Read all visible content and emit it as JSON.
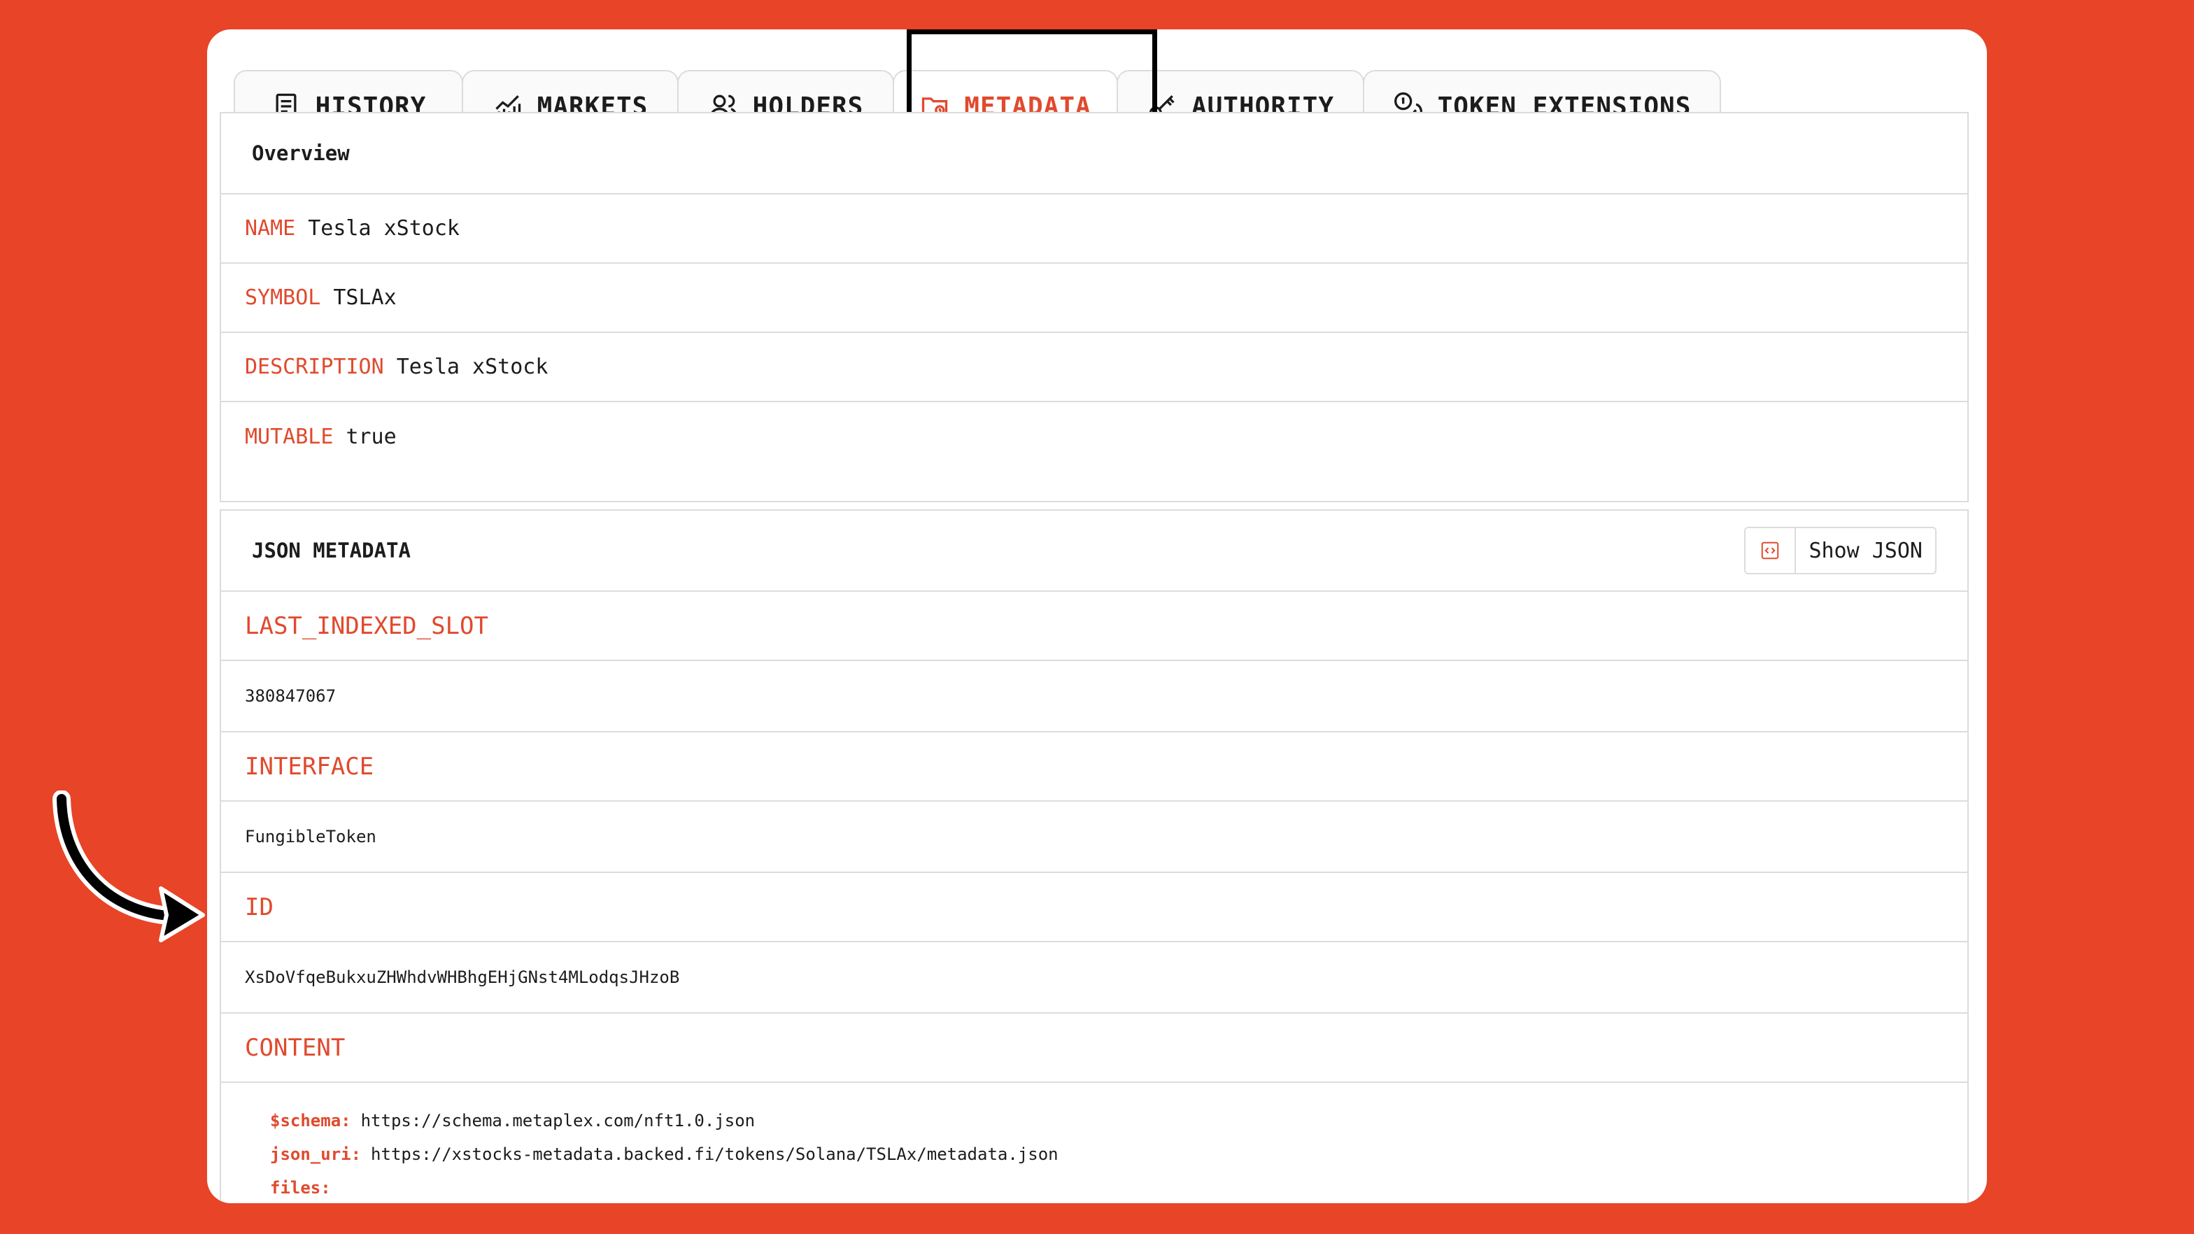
{
  "tabs": [
    {
      "label": "HISTORY",
      "icon": "receipt-icon"
    },
    {
      "label": "MARKETS",
      "icon": "chart-icon"
    },
    {
      "label": "HOLDERS",
      "icon": "users-icon"
    },
    {
      "label": "METADATA",
      "icon": "folder-icon"
    },
    {
      "label": "AUTHORITY",
      "icon": "key-icon"
    },
    {
      "label": "TOKEN EXTENSIONS",
      "icon": "coins-icon"
    }
  ],
  "active_tab": "METADATA",
  "overview": {
    "title": "Overview",
    "rows": [
      {
        "key": "NAME",
        "value": "Tesla xStock"
      },
      {
        "key": "SYMBOL",
        "value": "TSLAx"
      },
      {
        "key": "DESCRIPTION",
        "value": "Tesla xStock"
      },
      {
        "key": "MUTABLE",
        "value": "true"
      }
    ]
  },
  "json_metadata": {
    "title": "JSON METADATA",
    "show_json_label": "Show JSON",
    "fields": [
      {
        "key": "LAST_INDEXED_SLOT",
        "value": "380847067"
      },
      {
        "key": "INTERFACE",
        "value": "FungibleToken"
      },
      {
        "key": "ID",
        "value": "XsDoVfqeBukxuZHWhdvWHBhgEHjGNst4MLodqsJHzoB"
      }
    ],
    "content": {
      "key": "CONTENT",
      "lines": [
        {
          "key": "$schema:",
          "value": "https://schema.metaplex.com/nft1.0.json"
        },
        {
          "key": "json_uri:",
          "value": "https://xstocks-metadata.backed.fi/tokens/Solana/TSLAx/metadata.json"
        },
        {
          "key": "files:",
          "value": ""
        }
      ]
    }
  },
  "colors": {
    "background": "#E84427",
    "accent": "#E04A2E",
    "border": "#dcdcdc"
  }
}
